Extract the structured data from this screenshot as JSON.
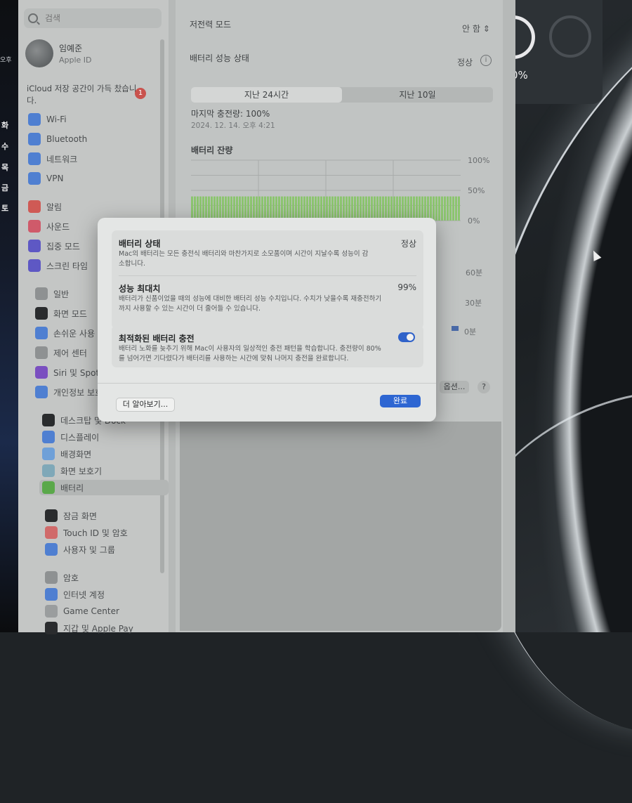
{
  "desktop": {
    "calendar_days": [
      "화",
      "수",
      "목",
      "금",
      "토"
    ],
    "clock_label": "오후",
    "widget_percent": "0%"
  },
  "sidebar": {
    "search_placeholder": "검색",
    "profile": {
      "name": "임예준",
      "subtitle": "Apple ID"
    },
    "icloud_notice": "iCloud 저장 공간이 가득 찼습니다.",
    "icloud_badge": "1",
    "items": [
      {
        "label": "Wi-Fi",
        "icon": "wifi-icon",
        "color": "#4f7fd1"
      },
      {
        "label": "Bluetooth",
        "icon": "bluetooth-icon",
        "color": "#4f7fd1"
      },
      {
        "label": "네트워크",
        "icon": "globe-icon",
        "color": "#4f7fd1"
      },
      {
        "label": "VPN",
        "icon": "vpn-icon",
        "color": "#4f7fd1"
      },
      {
        "label": "알림",
        "icon": "bell-icon",
        "color": "#cf5a55"
      },
      {
        "label": "사운드",
        "icon": "speaker-icon",
        "color": "#cf5a6a"
      },
      {
        "label": "집중 모드",
        "icon": "moon-icon",
        "color": "#5e58c4"
      },
      {
        "label": "스크린 타임",
        "icon": "hourglass-icon",
        "color": "#5e58c4"
      },
      {
        "label": "일반",
        "icon": "gear-icon",
        "color": "#8e9192"
      },
      {
        "label": "화면 모드",
        "icon": "appearance-icon",
        "color": "#2a2c2e"
      },
      {
        "label": "손쉬운 사용",
        "icon": "accessibility-icon",
        "color": "#4f7fd1"
      },
      {
        "label": "제어 센터",
        "icon": "control-center-icon",
        "color": "#8e9192"
      },
      {
        "label": "Siri 및 Spotlight",
        "icon": "siri-icon",
        "color": "#7a4fc0"
      },
      {
        "label": "개인정보 보호 및 보안",
        "icon": "hand-icon",
        "color": "#4f7fd1"
      },
      {
        "label": "데스크탑 및 Dock",
        "icon": "dock-icon",
        "color": "#2a2c2e"
      },
      {
        "label": "디스플레이",
        "icon": "display-icon",
        "color": "#4f7fd1"
      },
      {
        "label": "배경화면",
        "icon": "wallpaper-icon",
        "color": "#6fa0d8"
      },
      {
        "label": "화면 보호기",
        "icon": "screensaver-icon",
        "color": "#7fa8b8"
      },
      {
        "label": "배터리",
        "icon": "battery-icon",
        "color": "#5aa84a",
        "selected": true
      },
      {
        "label": "잠금 화면",
        "icon": "lock-icon",
        "color": "#2a2c2e"
      },
      {
        "label": "Touch ID 및 암호",
        "icon": "fingerprint-icon",
        "color": "#d06a6a"
      },
      {
        "label": "사용자 및 그룹",
        "icon": "users-icon",
        "color": "#4f7fd1"
      },
      {
        "label": "암호",
        "icon": "key-icon",
        "color": "#8e9192"
      },
      {
        "label": "인터넷 계정",
        "icon": "at-icon",
        "color": "#4f7fd1"
      },
      {
        "label": "Game Center",
        "icon": "game-center-icon",
        "color": "#9a9d9e"
      },
      {
        "label": "지갑 및 Apple Pay",
        "icon": "wallet-icon",
        "color": "#2a2c2e"
      }
    ]
  },
  "main": {
    "low_power_label": "저전력 모드",
    "low_power_value": "안 함",
    "health_label": "배터리 성능 상태",
    "health_value": "정상",
    "tabs": [
      {
        "label": "지난 24시간",
        "active": true
      },
      {
        "label": "지난 10일",
        "active": false
      }
    ],
    "last_charge": "마지막 충전량: 100%",
    "last_charge_date": "2024. 12. 14. 오후 4:21",
    "options_label": "옵션...",
    "help_label": "?"
  },
  "chart_data": {
    "type": "bar",
    "title": "배터리 잔량",
    "ylabel": "",
    "xlabel": "",
    "ylim": [
      0,
      100
    ],
    "yticks": [
      "100%",
      "50%",
      "0%"
    ],
    "bar_count": 96,
    "values_percent": 40,
    "bar_color": "#8cc56f",
    "secondary_axis_ticks": [
      "60분",
      "30분",
      "0분"
    ],
    "grid": true
  },
  "dialog": {
    "sections": [
      {
        "title": "배터리 상태",
        "value": "정상",
        "description": "Mac의 배터리는 모든 충전식 배터리와 마찬가지로 소모품이며 시간이 지날수록 성능이 감소합니다."
      },
      {
        "title": "성능 최대치",
        "value": "99%",
        "description": "배터리가 신품이었을 때의 성능에 대비한 배터리 성능 수치입니다. 수치가 낮을수록 재충전하기까지 사용할 수 있는 시간이 더 줄어들 수 있습니다."
      },
      {
        "title": "최적화된 배터리 충전",
        "toggle_on": true,
        "description": "배터리 노화를 늦추기 위해 Mac이 사용자의 일상적인 충전 패턴을 학습합니다. 충전량이 80%를 넘어가면 기다렸다가 배터리를 사용하는 시간에 맞춰 나머지 충전을 완료합니다."
      }
    ],
    "learn_more_label": "더 알아보기...",
    "done_label": "완료"
  }
}
